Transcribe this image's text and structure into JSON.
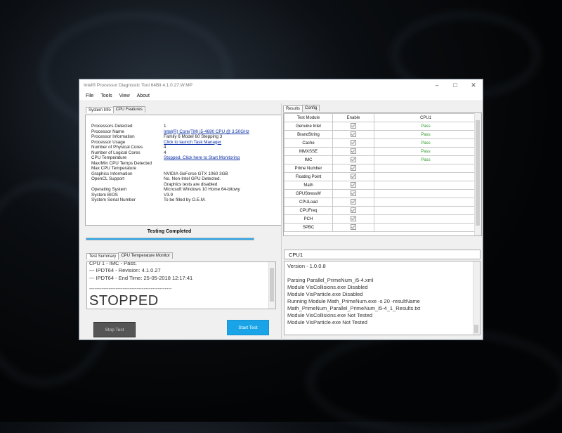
{
  "window": {
    "title": "Intel® Processor Diagnostic Tool 64Bit 4.1.0.27.W.MP",
    "controls": {
      "minimize": "–",
      "maximize": "□",
      "close": "✕"
    }
  },
  "menu": [
    "File",
    "Tools",
    "View",
    "About"
  ],
  "left_tabs": [
    "System Info",
    "CPU Features"
  ],
  "system_info": {
    "labels": [
      "Processors Detected",
      "Processor Name",
      "Processor Information",
      "Processor Usage",
      "Number of Physical Cores",
      "Number of Logical Cores",
      "CPU Temperature",
      "Max/Min CPU Temps Detected",
      "Max CPU Temperature",
      "Graphics Information",
      "OpenCL Support",
      "",
      "Operating System",
      "System BIOS",
      "System Serial Number"
    ],
    "values": [
      "1",
      "Intel(R) Core(TM) i5-4690 CPU @ 3.50GHz",
      "Family 6 Model 60 Stepping 3",
      "Click to launch Task Manager",
      "4",
      "4",
      "Stopped. Click here to Start Monitoring",
      "",
      "",
      "NVIDIA GeForce GTX 1060 3GB",
      "No. Non-Intel GPU Detected.",
      "Graphics tests are disabled",
      "Microsoft Windows 10 Home 64-bitowy",
      "V3.9",
      "To be filled by O.E.M."
    ]
  },
  "status": {
    "text": "Testing Completed",
    "progress": 1.0
  },
  "summary_tabs": [
    "Test Summary",
    "CPU Temperature Monitor"
  ],
  "summary_log": [
    "CPU 1 - IMC - Pass.",
    "--- IPDT64 - Revision: 4.1.0.27",
    "--- IPDT64 - End Time: 25-05-2018 12:17:41",
    "-----------------------------------------------"
  ],
  "stopped_text": "STOPPED",
  "buttons": {
    "stop": "Stop Test",
    "start": "Start Test"
  },
  "right_tabs": [
    "Results",
    "Config"
  ],
  "results": {
    "headers": [
      "Test Module",
      "Enable",
      "CPU1"
    ],
    "rows": [
      {
        "module": "Genuine Intel",
        "result": "Pass"
      },
      {
        "module": "BrandString",
        "result": "Pass"
      },
      {
        "module": "Cache",
        "result": "Pass"
      },
      {
        "module": "MMXSSE",
        "result": "Pass"
      },
      {
        "module": "IMC",
        "result": "Pass"
      },
      {
        "module": "Prime Number",
        "result": ""
      },
      {
        "module": "Floating Point",
        "result": ""
      },
      {
        "module": "Math",
        "result": ""
      },
      {
        "module": "GPUStressW",
        "result": ""
      },
      {
        "module": "CPULoad",
        "result": ""
      },
      {
        "module": "CPUFreq",
        "result": ""
      },
      {
        "module": "PCH",
        "result": ""
      },
      {
        "module": "SPBC",
        "result": ""
      }
    ]
  },
  "cpu1": {
    "tab": "CPU1",
    "log": [
      "Version - 1.0.0.8",
      "",
      "Parsing Parallel_PrimeNum_i5-4.xml",
      "Module VisCollisions.exe Disabled",
      "Module VisParticle.exe Disabled",
      "Running Module Math_PrimeNum.exe -s 20 -resultName",
      "Math_PrimeNum_Parallel_PrimeNum_i5-4_1_Results.txt",
      "Module VisCollisions.exe Not Tested",
      "Module VisParticle.exe Not Tested"
    ]
  },
  "colors": {
    "accent": "#1aa4e8",
    "pass": "#2a9a2a",
    "link": "#0b2fa8"
  }
}
